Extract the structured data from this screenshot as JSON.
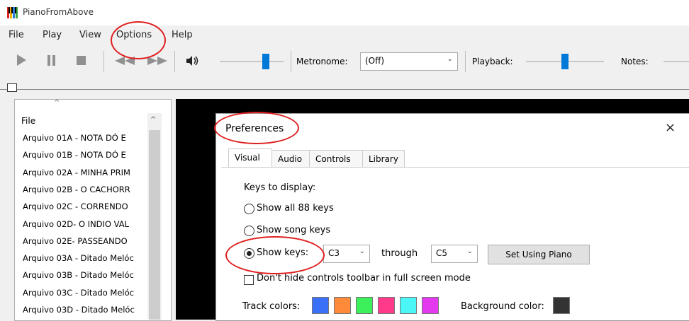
{
  "window": {
    "title": "PianoFromAbove",
    "icon": "piano-app-icon"
  },
  "menu": [
    {
      "label": "File"
    },
    {
      "label": "Play"
    },
    {
      "label": "View"
    },
    {
      "label": "Options"
    },
    {
      "label": "Help"
    }
  ],
  "toolbar": {
    "play_icon": "play-icon",
    "pause_icon": "pause-icon",
    "stop_icon": "stop-icon",
    "rewind_icon": "rewind-icon",
    "forward_icon": "fast-forward-icon",
    "volume_icon": "speaker-icon",
    "volume_level": 0.72,
    "metronome_label": "Metronome:",
    "metronome_value": "(Off)",
    "playback_label": "Playback:",
    "playback_level": 0.5,
    "notes_label": "Notes:"
  },
  "filelist": {
    "header": "File",
    "items": [
      "Arquivo 01A - NOTA DÓ E",
      "Arquivo 01B - NOTA DÓ E",
      "Arquivo 02A - MINHA PRIM",
      "Arquivo 02B - O CACHORR",
      "Arquivo 02C - CORRENDO",
      "Arquivo 02D- O INDIO VAL",
      "Arquivo 02E- PASSEANDO",
      "Arquivo 03A - Ditado Melóc",
      "Arquivo 03B - Ditado Melóc",
      "Arquivo 03C - Ditado Melóc",
      "Arquivo 03D - Ditado Melóc"
    ]
  },
  "dialog": {
    "title": "Preferences",
    "close": "×",
    "tabs": [
      "Visual",
      "Audio",
      "Controls",
      "Library"
    ],
    "keys_to_display_label": "Keys to display:",
    "opt_all": "Show all 88 keys",
    "opt_song": "Show song keys",
    "opt_keys": "Show keys:",
    "from_key": "C3",
    "through_label": "through",
    "to_key": "C5",
    "set_using_piano": "Set Using Piano",
    "fullscreen_checkbox": "Don't hide controls toolbar in full screen mode",
    "track_colors_label": "Track colors:",
    "track_colors": [
      "#3a6ff7",
      "#ff8a3a",
      "#3bf05a",
      "#ff3a8a",
      "#4af6f6",
      "#e33af0"
    ],
    "background_color_label": "Background color:",
    "background_color": "#333333"
  },
  "annotation_color": "#e02020"
}
